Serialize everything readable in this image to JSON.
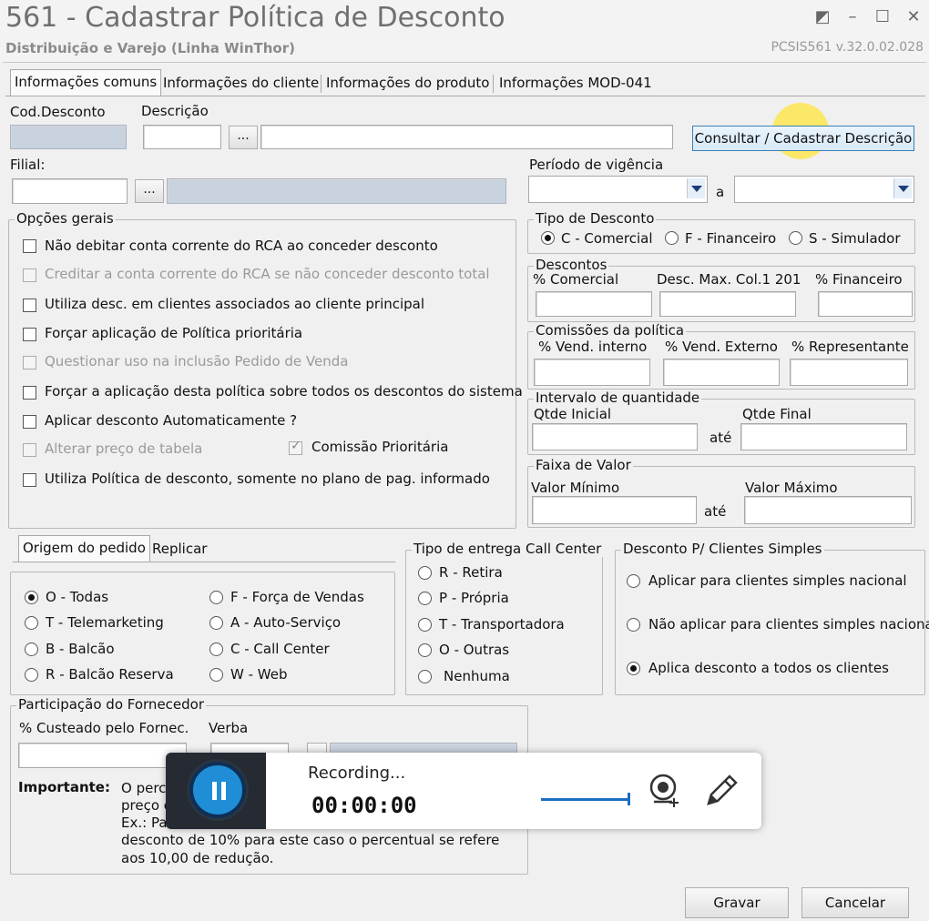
{
  "window": {
    "title": "561 - Cadastrar Política de Desconto",
    "subtitle": "Distribuição e Varejo (Linha WinThor)",
    "version": "PCSIS561  v.32.0.02.028"
  },
  "tabs": [
    "Informações comuns",
    "Informações do cliente",
    "Informações do produto",
    "Informações MOD-041"
  ],
  "header": {
    "cod_label": "Cod.Desconto",
    "desc_label": "Descrição",
    "consult_btn": "Consultar / Cadastrar Descrição",
    "filial_label": "Filial:",
    "periodo_label": "Período de vigência",
    "periodo_sep": "a",
    "dots": "..."
  },
  "opcoes": {
    "legend": "Opções gerais",
    "items": [
      {
        "label": "Não debitar conta corrente do RCA ao conceder desconto",
        "enabled": true,
        "checked": false
      },
      {
        "label": "Creditar a conta corrente do RCA se não conceder desconto total",
        "enabled": false,
        "checked": false
      },
      {
        "label": "Utiliza desc. em clientes associados ao cliente principal",
        "enabled": true,
        "checked": false
      },
      {
        "label": "Forçar aplicação de Política prioritária",
        "enabled": true,
        "checked": false
      },
      {
        "label": "Questionar uso na inclusão Pedido de Venda",
        "enabled": false,
        "checked": false
      },
      {
        "label": "Forçar a aplicação desta política sobre todos os descontos do sistema",
        "enabled": true,
        "checked": false
      },
      {
        "label": "Aplicar desconto Automaticamente ?",
        "enabled": true,
        "checked": false
      },
      {
        "label": "Alterar preço de tabela",
        "enabled": false,
        "checked": false
      },
      {
        "label": "Utiliza Política de desconto, somente no plano de pag. informado",
        "enabled": true,
        "checked": false
      }
    ],
    "comissao": {
      "label": "Comissão Prioritária",
      "checked": true
    }
  },
  "tipo_desconto": {
    "legend": "Tipo de Desconto",
    "options": [
      "C - Comercial",
      "F - Financeiro",
      "S - Simulador"
    ],
    "selected": "C - Comercial"
  },
  "descontos": {
    "legend": "Descontos",
    "cols": [
      "% Comercial",
      "Desc. Max. Col.1 201",
      "% Financeiro"
    ]
  },
  "comissoes": {
    "legend": "Comissões da política",
    "cols": [
      "% Vend. interno",
      "% Vend. Externo",
      "% Representante"
    ]
  },
  "intervalo": {
    "legend": "Intervalo de quantidade",
    "ini": "Qtde Inicial",
    "fim": "Qtde Final",
    "sep": "até"
  },
  "faixa": {
    "legend": "Faixa de Valor",
    "min": "Valor Mínimo",
    "max": "Valor Máximo",
    "sep": "até"
  },
  "origem": {
    "tabs": [
      "Origem do pedido",
      "Replicar"
    ],
    "options": [
      "O - Todas",
      "T - Telemarketing",
      "B - Balcão",
      "R - Balcão Reserva",
      "F - Força de Vendas",
      "A - Auto-Serviço",
      "C - Call Center",
      "W - Web"
    ],
    "selected": "O - Todas"
  },
  "entrega": {
    "legend": "Tipo de entrega Call Center",
    "options": [
      "R - Retira",
      "P - Própria",
      "T - Transportadora",
      "O - Outras",
      "Nenhuma"
    ]
  },
  "simples": {
    "legend": "Desconto P/ Clientes Simples",
    "options": [
      "Aplicar para clientes simples nacional",
      "Não aplicar para clientes simples nacional",
      "Aplica desconto a todos os clientes"
    ],
    "selected": "Aplica desconto a todos os clientes"
  },
  "fornecedor": {
    "legend": "Participação do Fornecedor",
    "custeado": "% Custeado pelo Fornec.",
    "verba": "Verba",
    "importante_label": "Importante:",
    "note_lines": [
      "O perce",
      "preço c",
      "Ex.: Pa",
      "desconto de 10% para este caso o percentual se refere",
      "aos 10,00 de redução."
    ]
  },
  "footer": {
    "gravar": "Gravar",
    "cancelar": "Cancelar"
  },
  "recorder": {
    "status": "Recording...",
    "time": "00:00:00"
  }
}
